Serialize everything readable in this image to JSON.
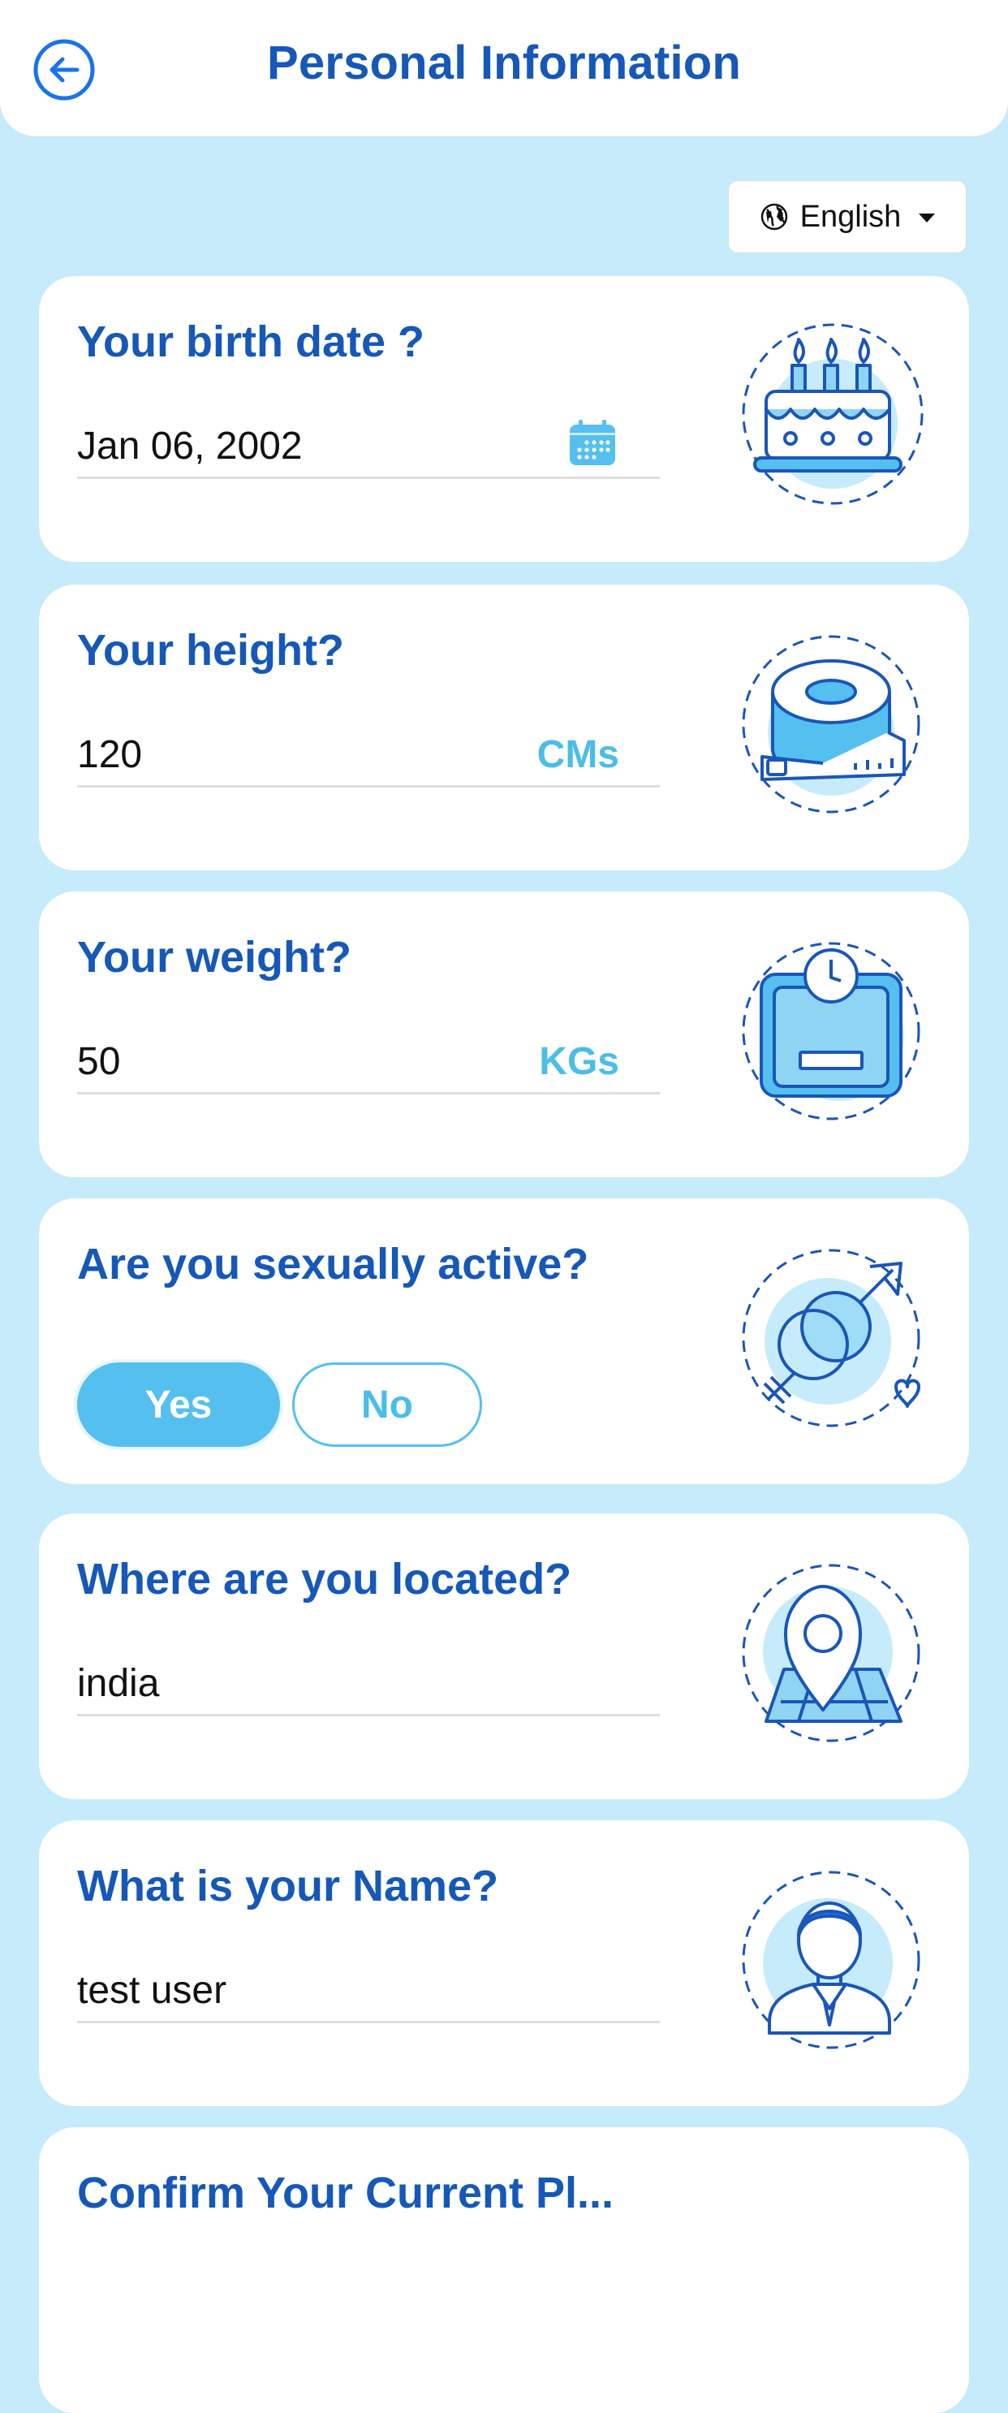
{
  "header": {
    "title": "Personal Information"
  },
  "language": {
    "selected": "English"
  },
  "birth": {
    "question": "Your birth date ?",
    "value": "Jan 06, 2002"
  },
  "height": {
    "question": "Your height?",
    "value": "120",
    "unit": "CMs"
  },
  "weight": {
    "question": "Your weight?",
    "value": "50",
    "unit": "KGs"
  },
  "sexual": {
    "question": "Are you sexually active?",
    "yes": "Yes",
    "no": "No",
    "selected": "Yes"
  },
  "location": {
    "question": "Where are you located?",
    "value": "india"
  },
  "name": {
    "question": "What is your Name?",
    "value": "test user"
  },
  "next_card": {
    "question": "Confirm Your Current Pl..."
  },
  "colors": {
    "primary": "#1558b8",
    "accent": "#55bff0",
    "background": "#c6ebfb"
  }
}
